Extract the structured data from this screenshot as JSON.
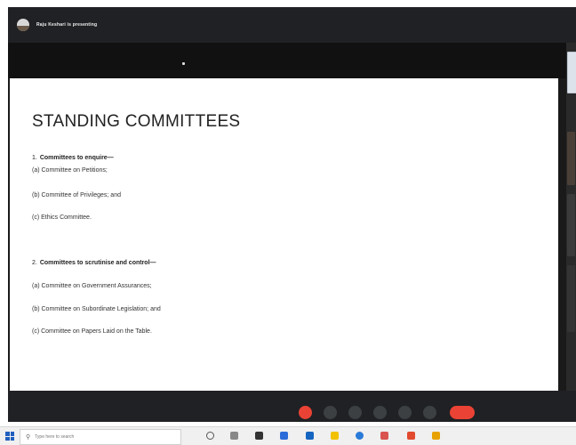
{
  "meet": {
    "presenting": "Raju Keshari is presenting",
    "meeting_info": "",
    "controls": [
      "mic-button",
      "camera-button",
      "captions-button",
      "present-button",
      "raise-hand-button",
      "more-options-button",
      "leave-call-button"
    ]
  },
  "slide": {
    "title": "STANDING COMMITTEES",
    "sections": [
      {
        "number": "1.",
        "heading": "Committees to enquire—",
        "items": [
          "(a) Committee on Petitions;",
          "(b) Committee of Privileges; and",
          "(c) Ethics Committee."
        ]
      },
      {
        "number": "2.",
        "heading": "Committees to scrutinise and control—",
        "items": [
          "(a) Committee on Government Assurances;",
          "(b) Committee on Subordinate Legislation; and",
          "(c) Committee on Papers Laid on the Table."
        ]
      }
    ]
  },
  "taskbar": {
    "search_placeholder": "Type here to search",
    "tray": ""
  },
  "colors": {
    "meet_bg": "#202124",
    "end_call": "#ea4335",
    "slide_bg": "#ffffff"
  }
}
